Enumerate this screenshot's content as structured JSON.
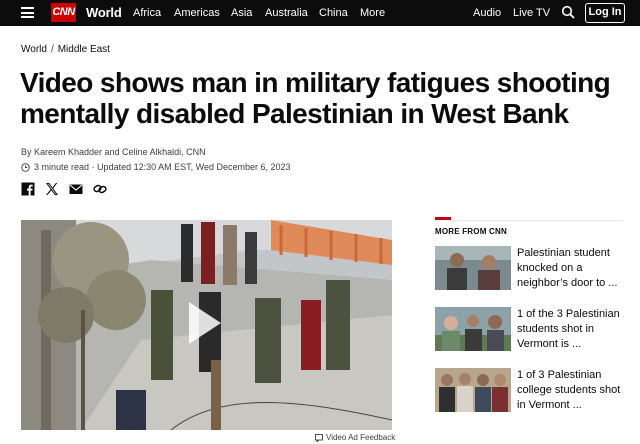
{
  "nav": {
    "logo": "CNN",
    "section": "World",
    "links": [
      "Africa",
      "Americas",
      "Asia",
      "Australia",
      "China",
      "More"
    ],
    "right_links": [
      "Audio",
      "Live TV"
    ],
    "login": "Log In",
    "icons": [
      "hamburger-menu-icon",
      "search-icon"
    ]
  },
  "breadcrumb": {
    "first": "World",
    "separator": "/",
    "second": "Middle East"
  },
  "article": {
    "headline": "Video shows man in military fatigues shooting mentally disabled Palestinian in West Bank",
    "byline": "By Kareem Khadder and Celine Alkhaldi, CNN",
    "read_time": "3 minute read",
    "updated": "· Updated 12:30 AM EST, Wed December 6, 2023"
  },
  "share_icons": [
    "facebook-icon",
    "x-twitter-icon",
    "email-icon",
    "link-icon"
  ],
  "video": {
    "ad_feedback": "Video Ad Feedback"
  },
  "more": {
    "title": "MORE FROM CNN",
    "items": [
      {
        "text": "Palestinian student knocked on a neighbor’s door to ..."
      },
      {
        "text": "1 of the 3 Palestinian students shot in Vermont is ..."
      },
      {
        "text": "1 of 3 Palestinian college students shot in Vermont ..."
      }
    ]
  },
  "colors": {
    "brand": "#cc0000",
    "nav_bg": "#0c0c0c"
  }
}
